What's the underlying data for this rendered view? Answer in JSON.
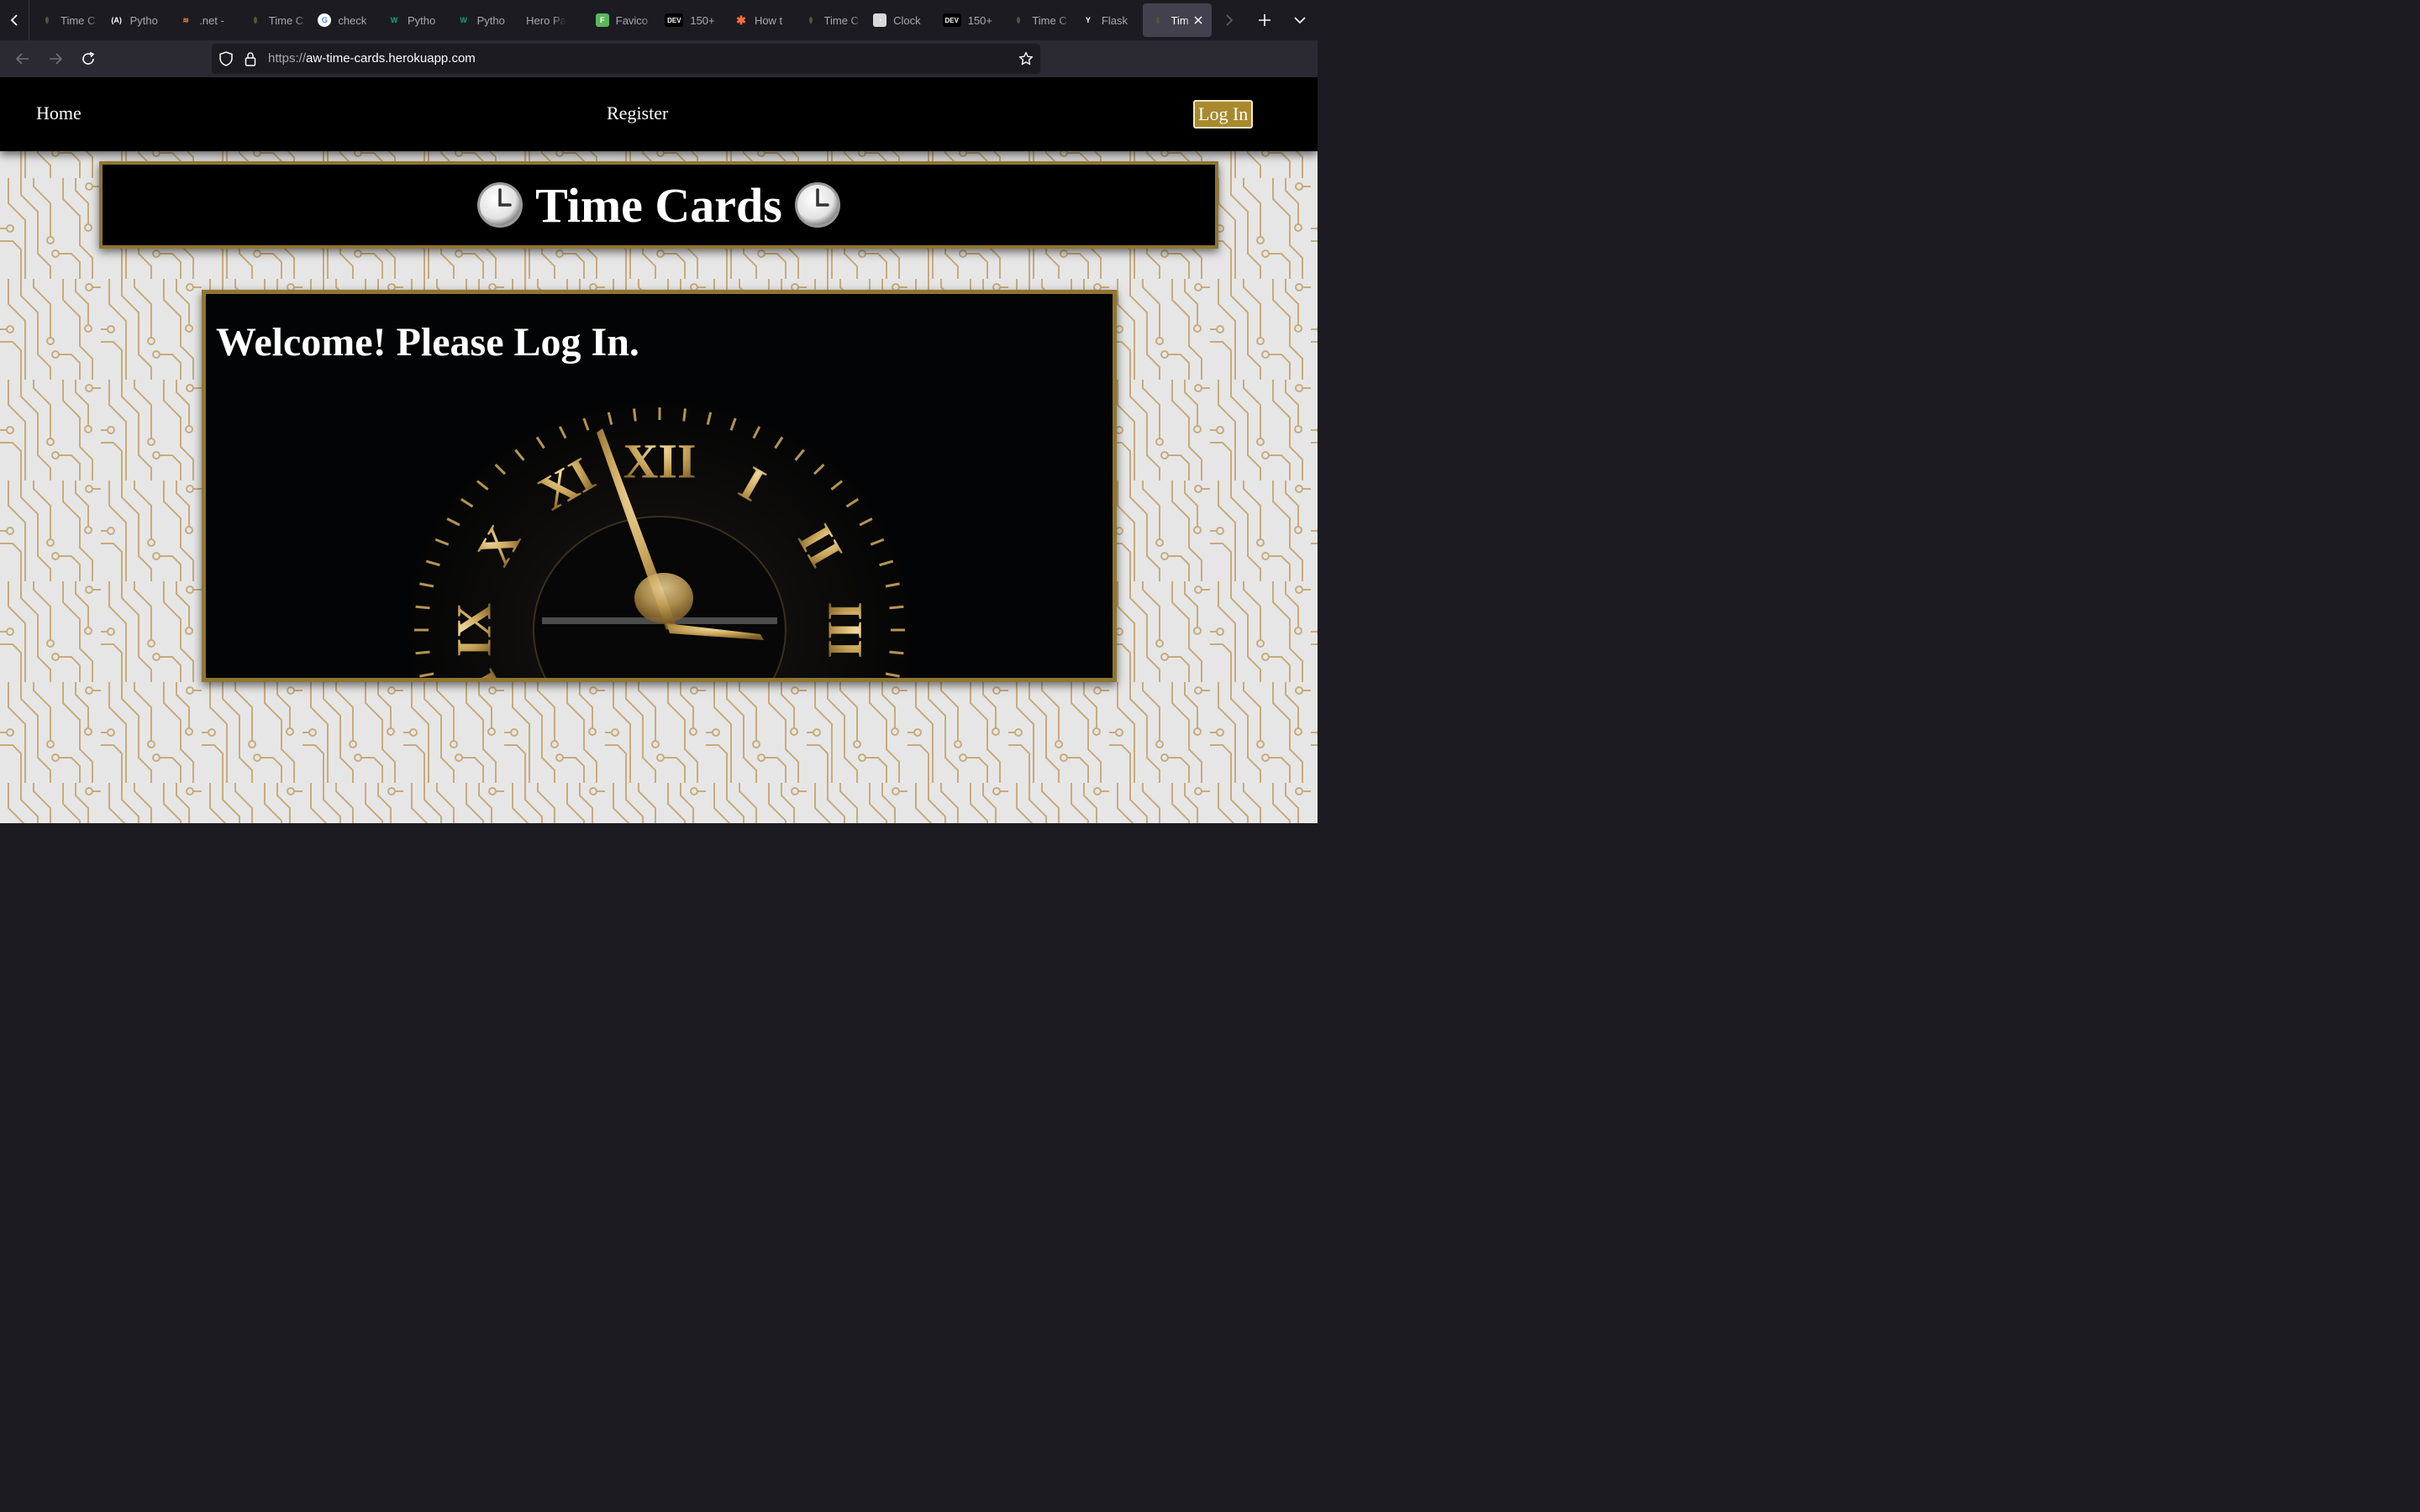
{
  "browser": {
    "tabs": [
      {
        "label": "Time C",
        "icon": "leaf-favicon-icon",
        "active": false
      },
      {
        "label": "Pytho",
        "icon": "python-favicon-icon",
        "active": false
      },
      {
        "label": ".net -",
        "icon": "stackoverflow-favicon-icon",
        "active": false
      },
      {
        "label": "Time C",
        "icon": "leaf-favicon-icon",
        "active": false
      },
      {
        "label": "check",
        "icon": "google-favicon-icon",
        "active": false
      },
      {
        "label": "Pytho",
        "icon": "w3schools-favicon-icon",
        "active": false
      },
      {
        "label": "Pytho",
        "icon": "w3schools-favicon-icon",
        "active": false
      },
      {
        "label": "Hero Patte",
        "icon": "",
        "active": false
      },
      {
        "label": "Favico",
        "icon": "favicon-generator-icon",
        "active": false
      },
      {
        "label": "150+",
        "icon": "dev-favicon-icon",
        "active": false
      },
      {
        "label": "How t",
        "icon": "asterisk-favicon-icon",
        "active": false
      },
      {
        "label": "Time C",
        "icon": "leaf-favicon-icon",
        "active": false
      },
      {
        "label": "Clock",
        "icon": "clock-favicon-icon",
        "active": false
      },
      {
        "label": "150+",
        "icon": "dev-favicon-icon",
        "active": false
      },
      {
        "label": "Time C",
        "icon": "leaf-favicon-icon",
        "active": false
      },
      {
        "label": "Flask",
        "icon": "flask-favicon-icon",
        "active": false
      },
      {
        "label": "Tim",
        "icon": "leaf-favicon-icon",
        "active": true
      }
    ],
    "url": {
      "protocol": "https://",
      "host": "aw-time-cards.herokuapp.com"
    }
  },
  "site": {
    "nav": {
      "home": "Home",
      "register": "Register",
      "login": "Log In"
    },
    "title": "Time Cards",
    "welcome": "Welcome! Please Log In."
  },
  "colors": {
    "gold": "#8f7530",
    "login_bg": "#a8892e",
    "pattern_bg": "#e6e6e6",
    "pattern_line": "#c7ab7c"
  }
}
